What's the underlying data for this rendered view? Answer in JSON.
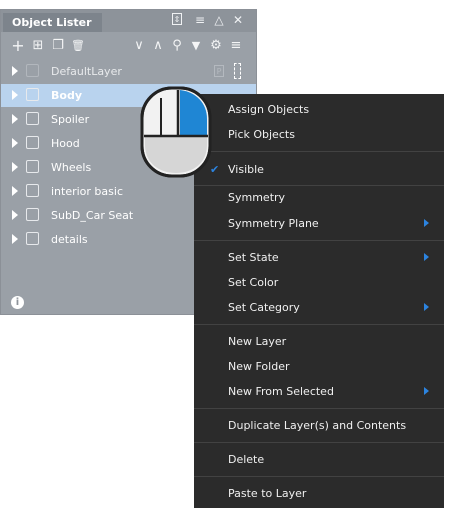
{
  "panel": {
    "title": "Object Lister",
    "titlebar_icons": [
      "pin-icon",
      "list-icon",
      "triangle-icon",
      "close-icon"
    ],
    "titlebar_glyphs": [
      "⇕",
      "≡",
      "△",
      "✕"
    ],
    "toolbar_left": [
      {
        "name": "add-icon",
        "glyph": "+"
      },
      {
        "name": "add-folder-icon",
        "glyph": "⊞"
      },
      {
        "name": "duplicate-icon",
        "glyph": "❐"
      },
      {
        "name": "delete-icon",
        "glyph": "🗑"
      }
    ],
    "toolbar_right": [
      {
        "name": "collapse-down-icon",
        "glyph": "∨"
      },
      {
        "name": "collapse-up-icon",
        "glyph": "∧"
      },
      {
        "name": "search-icon",
        "glyph": "⚲"
      },
      {
        "name": "filter-icon",
        "glyph": "▼"
      },
      {
        "name": "gear-icon",
        "glyph": "⚙"
      },
      {
        "name": "menu-icon",
        "glyph": "≡"
      }
    ],
    "layers": [
      {
        "label": "DefaultLayer",
        "selected": false,
        "faint": true,
        "right_badge": "P"
      },
      {
        "label": "Body",
        "selected": true,
        "faint": false
      },
      {
        "label": "Spoiler",
        "selected": false,
        "faint": false
      },
      {
        "label": "Hood",
        "selected": false,
        "faint": false
      },
      {
        "label": "Wheels",
        "selected": false,
        "faint": false
      },
      {
        "label": "interior basic",
        "selected": false,
        "faint": false
      },
      {
        "label": "SubD_Car Seat",
        "selected": false,
        "faint": false
      },
      {
        "label": "details",
        "selected": false,
        "faint": false
      }
    ],
    "info_glyph": "i"
  },
  "context_menu": {
    "accent": "#2c84e0",
    "groups": [
      [
        {
          "label": "Assign Objects"
        },
        {
          "label": "Pick Objects"
        }
      ],
      [
        {
          "label": "Visible",
          "checked": true
        }
      ],
      [
        {
          "label": "Symmetry"
        },
        {
          "label": "Symmetry Plane",
          "submenu": true
        }
      ],
      [
        {
          "label": "Set State",
          "submenu": true
        },
        {
          "label": "Set Color"
        },
        {
          "label": "Set Category",
          "submenu": true
        }
      ],
      [
        {
          "label": "New Layer"
        },
        {
          "label": "New Folder"
        },
        {
          "label": "New From Selected",
          "submenu": true
        }
      ],
      [
        {
          "label": "Duplicate Layer(s) and Contents"
        }
      ],
      [
        {
          "label": "Delete"
        }
      ],
      [
        {
          "label": "Paste to Layer"
        }
      ]
    ]
  },
  "mouse_illustration": {
    "highlight_button": "right",
    "highlight_color": "#1f86d4"
  }
}
